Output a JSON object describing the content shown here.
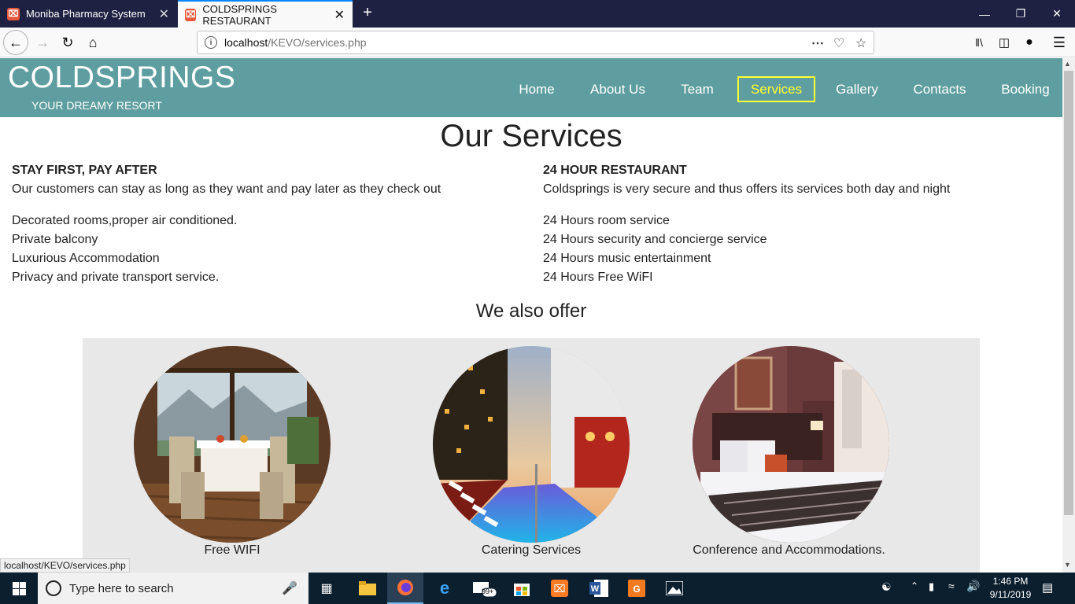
{
  "browser": {
    "tabs": [
      {
        "title": "Moniba Pharmacy System"
      },
      {
        "title": "COLDSPRINGS RESTAURANT"
      }
    ],
    "url_host": "localhost",
    "url_path": "/KEVO/services.php",
    "status_text": "localhost/KEVO/services.php"
  },
  "site": {
    "brand": "COLDSPRINGS",
    "tagline": "YOUR DREAMY RESORT",
    "menu": [
      "Home",
      "About Us",
      "Team",
      "Services",
      "Gallery",
      "Contacts",
      "Booking"
    ],
    "active_menu": "Services",
    "highlight_color": "#ffff33",
    "header_color": "#5f9ea0"
  },
  "services": {
    "title": "Our Services",
    "left": {
      "heading": "STAY FIRST, PAY AFTER",
      "description": "Our customers can stay as long as they want and pay later as they check out",
      "items": [
        "Decorated rooms,proper air conditioned.",
        "Private balcony",
        "Luxurious Accommodation",
        "Privacy and private transport service."
      ]
    },
    "right": {
      "heading": "24 HOUR RESTAURANT",
      "description": "Coldsprings is very secure and thus offers its services both day and night",
      "items": [
        "24 Hours room service",
        "24 Hours security and concierge service",
        "24 Hours music entertainment",
        "24 Hours Free WiFI"
      ]
    }
  },
  "offer": {
    "title": "We also offer",
    "cards": [
      {
        "caption": "Free WIFI",
        "image": "dining-room-photo"
      },
      {
        "caption": "Catering Services",
        "image": "rooftop-pool-photo"
      },
      {
        "caption": "Conference and Accommodations.",
        "image": "hotel-bedroom-photo"
      }
    ]
  },
  "taskbar": {
    "search_placeholder": "Type here to search",
    "time": "1:46 PM",
    "date": "9/11/2019",
    "mail_badge": "99+"
  }
}
